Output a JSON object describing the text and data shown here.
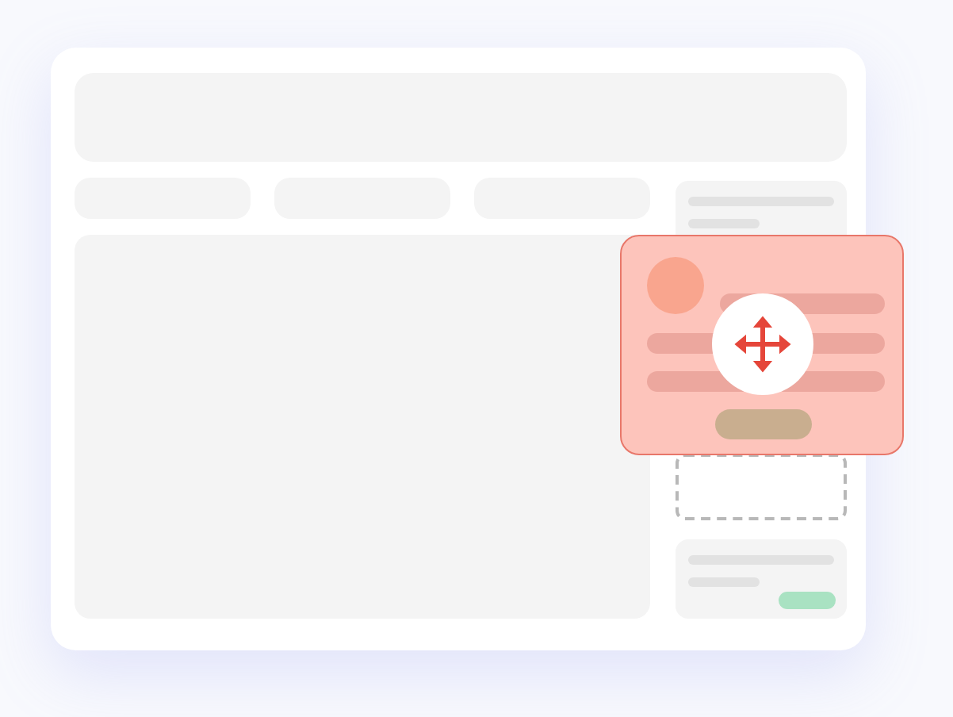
{
  "layout": {
    "kind": "wireframe"
  },
  "dragged_card": {
    "kind": "dragging"
  },
  "drop_target": {
    "kind": "dashed"
  }
}
